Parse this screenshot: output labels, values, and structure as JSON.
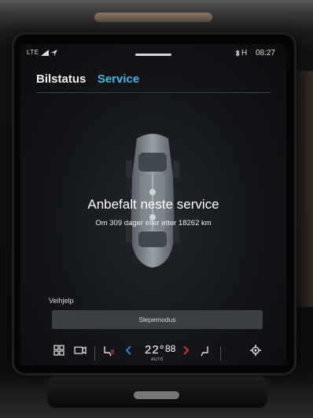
{
  "status_bar": {
    "signal": "LTE",
    "right_label": "H",
    "time": "08:27"
  },
  "tabs": [
    {
      "label": "Bilstatus",
      "active": false
    },
    {
      "label": "Service",
      "active": true
    }
  ],
  "service": {
    "headline": "Anbefalt neste service",
    "detail": "Om 309 dager eller etter 18262 km"
  },
  "assistance": {
    "section_label": "Veihjelp",
    "tow_mode_button": "Slepemodus"
  },
  "climate_bar": {
    "icons": [
      "app-grid-icon",
      "camera-icon",
      "seat-heat-left-icon",
      "chevron-left-icon",
      "chevron-right-icon",
      "seat-heat-right-icon",
      "climate-settings-icon"
    ],
    "temperature": "22°",
    "temperature_sub": "88",
    "mode": "AUTO"
  },
  "colors": {
    "accent": "#3fb8ea",
    "arrow_left": "#2d8fe0",
    "arrow_right": "#e0323a",
    "button_bg": "#3b3e42"
  }
}
